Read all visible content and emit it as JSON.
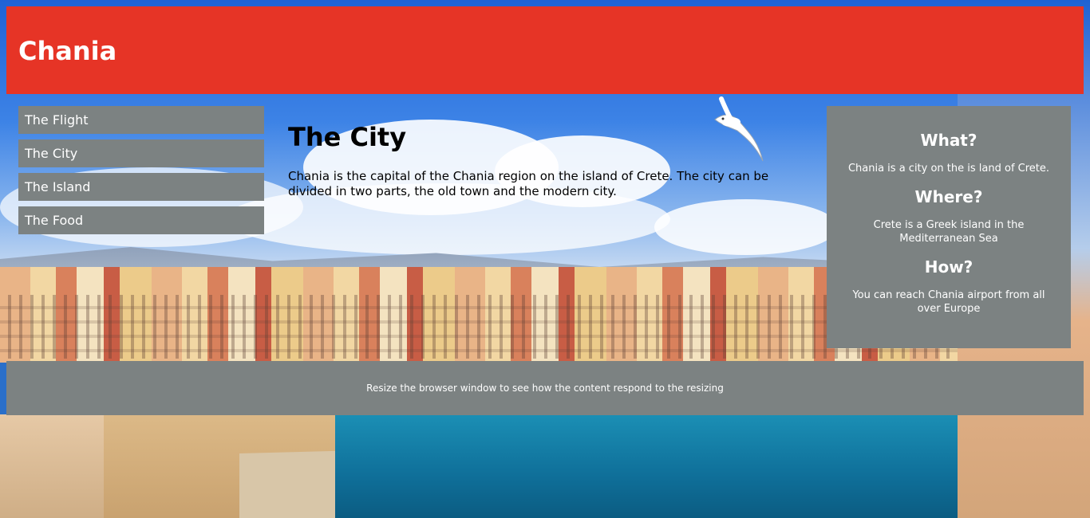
{
  "header": {
    "title": "Chania"
  },
  "menu": {
    "items": [
      {
        "label": "The Flight"
      },
      {
        "label": "The City"
      },
      {
        "label": "The Island"
      },
      {
        "label": "The Food"
      }
    ]
  },
  "main": {
    "heading": "The City",
    "paragraph": "Chania is the capital of the Chania region on the island of Crete. The city can be divided in two parts, the old town and the modern city."
  },
  "aside": {
    "sections": [
      {
        "heading": "What?",
        "text": "Chania is a city on the is land of Crete."
      },
      {
        "heading": "Where?",
        "text": "Crete is a Greek island in the Mediterranean Sea"
      },
      {
        "heading": "How?",
        "text": "You can reach Chania airport from all over Europe"
      }
    ]
  },
  "footer": {
    "text": "Resize the browser window to see how the content respond to the resizing"
  },
  "colors": {
    "header_bg": "#e63426",
    "panel_bg": "#7c8282",
    "text_light": "#ffffff"
  }
}
